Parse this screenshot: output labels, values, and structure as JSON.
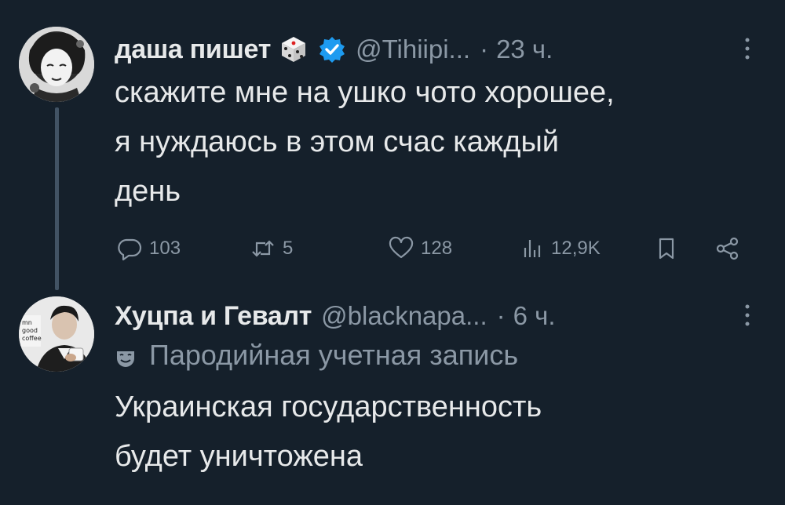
{
  "tweets": [
    {
      "display_name": "даша пишет",
      "emoji": "dice-emoji",
      "verified": true,
      "handle": "@Tihiipi...",
      "separator": "·",
      "time": "23 ч.",
      "text": "скажите мне на ушко чото хорошее,\nя нуждаюсь в этом счас каждый\nдень",
      "stats": {
        "replies": "103",
        "retweets": "5",
        "likes": "128",
        "views": "12,9K"
      }
    },
    {
      "display_name": "Хуцпа и Гевалт",
      "handle": "@blacknapa...",
      "separator": "·",
      "time": "6 ч.",
      "parody_label": "Пародийная учетная запись",
      "text": "Украинская государственность\nбудет уничтожена"
    }
  ],
  "colors": {
    "background": "#15202b",
    "text": "#e7e9ea",
    "muted": "#8b98a5",
    "verified": "#1d9bf0",
    "thread_line": "#425364"
  }
}
